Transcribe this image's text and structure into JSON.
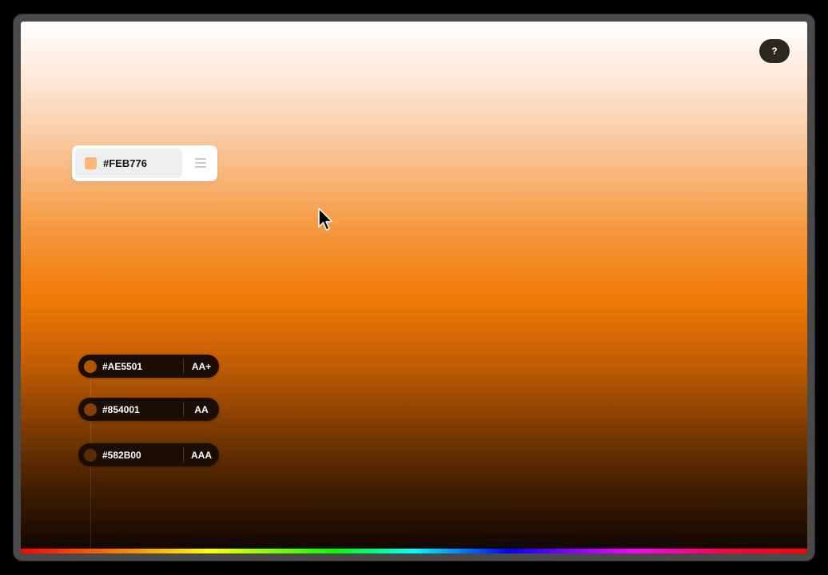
{
  "help_button": {
    "label": "?"
  },
  "base_color": {
    "hex": "#FEB776",
    "swatch_color": "#FEB776"
  },
  "shades": [
    {
      "hex": "#AE5501",
      "rating": "AA+",
      "color": "#AE5501"
    },
    {
      "hex": "#854001",
      "rating": "AA",
      "color": "#854001"
    },
    {
      "hex": "#582B00",
      "rating": "AAA",
      "color": "#582B00"
    }
  ]
}
